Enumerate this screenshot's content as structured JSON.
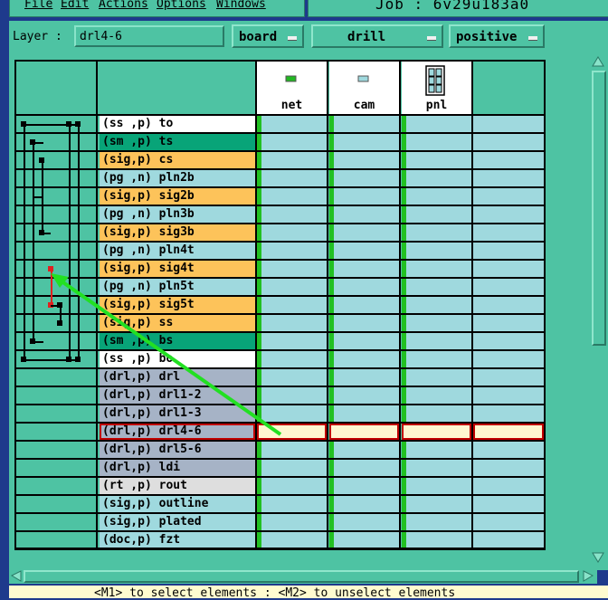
{
  "menu": {
    "items": [
      "File",
      "Edit",
      "Actions",
      "Options",
      "Windows"
    ]
  },
  "job_title": "Job : 6v29u183a0",
  "toolbar": {
    "layer_label": "Layer :",
    "layer_value": "drl4-6",
    "context_dropdown": "board",
    "type_dropdown": "drill",
    "polarity_dropdown": "positive"
  },
  "steps": [
    {
      "name": "net",
      "icon": "net-step-icon"
    },
    {
      "name": "cam",
      "icon": "cam-step-icon"
    },
    {
      "name": "pnl",
      "icon": "panel-step-icon"
    }
  ],
  "layers": [
    {
      "label": "(ss ,p) to",
      "color": "#ffffff"
    },
    {
      "label": "(sm ,p) ts",
      "color": "#08a478"
    },
    {
      "label": "(sig,p) cs",
      "color": "#fdc35a"
    },
    {
      "label": "(pg ,n) pln2b",
      "color": "#9fd9de"
    },
    {
      "label": "(sig,p) sig2b",
      "color": "#fdc35a"
    },
    {
      "label": "(pg ,n) pln3b",
      "color": "#9fd9de"
    },
    {
      "label": "(sig,p) sig3b",
      "color": "#fdc35a"
    },
    {
      "label": "(pg ,n) pln4t",
      "color": "#9fd9de"
    },
    {
      "label": "(sig,p) sig4t",
      "color": "#fdc35a"
    },
    {
      "label": "(pg ,n) pln5t",
      "color": "#9fd9de"
    },
    {
      "label": "(sig,p) sig5t",
      "color": "#fdc35a"
    },
    {
      "label": "(sig,p) ss",
      "color": "#fdc35a"
    },
    {
      "label": "(sm ,p) bs",
      "color": "#08a478"
    },
    {
      "label": "(ss ,p) bo",
      "color": "#ffffff"
    },
    {
      "label": "(drl,p) drl",
      "color": "#a6b3c6"
    },
    {
      "label": "(drl,p) drl1-2",
      "color": "#a6b3c6"
    },
    {
      "label": "(drl,p) drl1-3",
      "color": "#a6b3c6"
    },
    {
      "label": "(drl,p) drl4-6",
      "color": "#a6b3c6",
      "selected": true
    },
    {
      "label": "(drl,p) drl5-6",
      "color": "#a6b3c6"
    },
    {
      "label": "(drl,p) ldi",
      "color": "#a6b3c6"
    },
    {
      "label": "(rt ,p) rout",
      "color": "#dedede"
    },
    {
      "label": "(sig,p) outline",
      "color": "#9fd9de"
    },
    {
      "label": "(sig,p) plated",
      "color": "#9fd9de"
    },
    {
      "label": "(doc,p) fzt",
      "color": "#9fd9de"
    }
  ],
  "status_text": "<M1> to select elements : <M2> to unselect elements"
}
